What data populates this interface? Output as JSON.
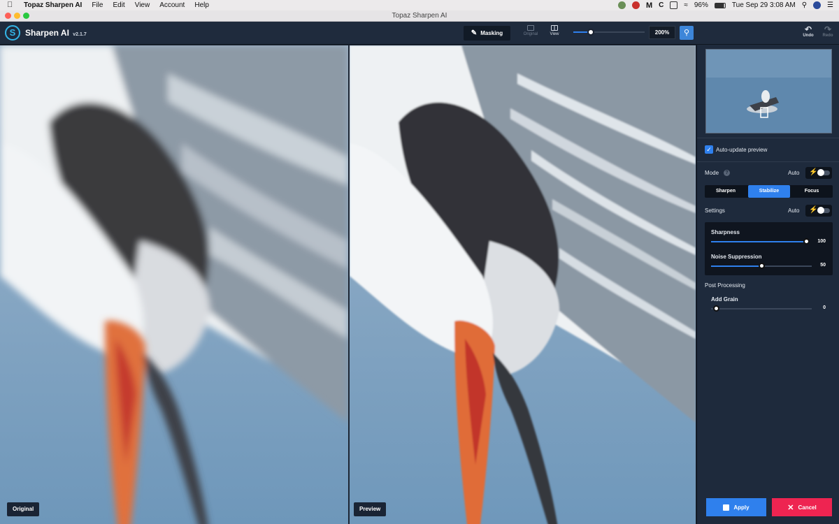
{
  "menubar": {
    "app_name": "Topaz Sharpen AI",
    "items": [
      "File",
      "Edit",
      "View",
      "Account",
      "Help"
    ],
    "battery": "96%",
    "datetime": "Tue Sep 29  3:08 AM"
  },
  "window": {
    "title": "Topaz Sharpen AI"
  },
  "toolbar": {
    "app_title": "Sharpen AI",
    "version": "v2.1.7",
    "masking_label": "Masking",
    "original_label": "Original",
    "view_label": "View",
    "zoom_value": "200%",
    "undo_label": "Undo",
    "redo_label": "Redo"
  },
  "panels": {
    "left_label": "Original",
    "right_label": "Preview"
  },
  "sidebar": {
    "auto_update_label": "Auto-update preview",
    "mode_label": "Mode",
    "mode_auto_label": "Auto",
    "mode_tabs": [
      "Sharpen",
      "Stabilize",
      "Focus"
    ],
    "mode_selected": "Stabilize",
    "settings_label": "Settings",
    "settings_auto_label": "Auto",
    "sharpness_label": "Sharpness",
    "sharpness_value": "100",
    "noise_label": "Noise Suppression",
    "noise_value": "50",
    "post_processing_label": "Post Processing",
    "grain_label": "Add Grain",
    "grain_value": "0",
    "apply_label": "Apply",
    "cancel_label": "Cancel"
  },
  "colors": {
    "accent": "#2f80ed",
    "cancel": "#ee2451",
    "app_bg": "#1e2a3c"
  }
}
